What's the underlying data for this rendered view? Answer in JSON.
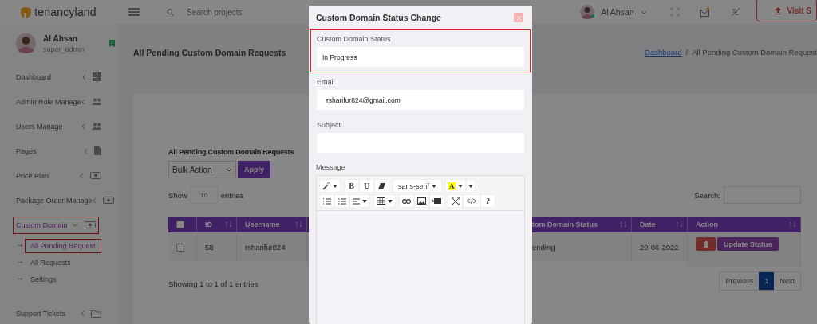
{
  "topbar": {
    "logo": "tenancyland",
    "search_placeholder": "Search projects",
    "user_name": "Al Ahsan",
    "visit_button": "Visit S"
  },
  "sidebar": {
    "profile": {
      "name": "Al Ahsan",
      "role": "super_admin"
    },
    "items": [
      {
        "label": "Dashboard",
        "selected": false,
        "highlighted": false
      },
      {
        "label": "Admin Role Manage",
        "selected": false,
        "highlighted": false
      },
      {
        "label": "Users Manage",
        "selected": false,
        "highlighted": false
      },
      {
        "label": "Pages",
        "selected": false,
        "highlighted": false
      },
      {
        "label": "Price Plan",
        "selected": false,
        "highlighted": false
      },
      {
        "label": "Package Order Manage",
        "selected": false,
        "highlighted": false
      },
      {
        "label": "Custom Domain",
        "selected": true,
        "highlighted": true,
        "expanded": true,
        "children": [
          {
            "label": "All Pending Request",
            "selected": true,
            "highlighted": true
          },
          {
            "label": "All Requests",
            "selected": false,
            "highlighted": false
          },
          {
            "label": "Settings",
            "selected": false,
            "highlighted": false
          }
        ]
      },
      {
        "label": "Support Tickets",
        "selected": false,
        "highlighted": false
      }
    ]
  },
  "page": {
    "title": "All Pending Custom Domain Requests",
    "separator": "/",
    "breadcrumb": [
      {
        "label": "Dashboard",
        "link": true
      },
      {
        "label": "All Pending Custom Domain Request",
        "link": false
      }
    ]
  },
  "card": {
    "heading": "All Pending Custom Domain Requests",
    "bulk_action": "Bulk Action",
    "apply": "Apply",
    "show": "Show",
    "page_length": "10",
    "entries": "entries",
    "search_label": "Search:",
    "table": {
      "select_all_checked": false,
      "columns": [
        {
          "kind": "text",
          "label": "ID"
        },
        {
          "kind": "text",
          "label": "Username"
        },
        {
          "kind": "text",
          "label": "tom Domain Status"
        },
        {
          "kind": "text",
          "label": "Date"
        },
        {
          "kind": "text",
          "label": "Action"
        }
      ],
      "rows": [
        {
          "checked": false,
          "cells": [
            "58",
            "rsharifur824",
            "ending",
            "29-06-2022"
          ],
          "action": "Update Status"
        }
      ]
    },
    "info": "Showing 1 to 1 of 1 entries",
    "pagination": [
      {
        "label": "Previous",
        "selected": false
      },
      {
        "label": "1",
        "selected": true
      },
      {
        "label": "Next",
        "selected": false
      }
    ]
  },
  "modal": {
    "title": "Custom Domain Status Change",
    "fields": [
      {
        "label": "Custom Domain Status",
        "value": "In Progress",
        "highlighted": true
      },
      {
        "label": "Email",
        "value": "rsharifur824@gmail.com",
        "highlighted": false
      },
      {
        "label": "Subject",
        "highlighted": false
      }
    ],
    "message_label": "Message",
    "toolbar": [
      [
        [
          {
            "kind": "magic"
          }
        ],
        [
          {
            "kind": "text",
            "label": "B"
          },
          {
            "kind": "text",
            "label": "U"
          },
          {
            "kind": "eraser"
          }
        ],
        [
          {
            "kind": "font",
            "label": "sans-serif"
          }
        ],
        [
          {
            "kind": "color",
            "label": "A"
          }
        ]
      ],
      [
        [
          {
            "kind": "ul"
          },
          {
            "kind": "ol"
          },
          {
            "kind": "align"
          }
        ],
        [
          {
            "kind": "table"
          }
        ],
        [
          {
            "kind": "link"
          },
          {
            "kind": "image"
          },
          {
            "kind": "video"
          }
        ],
        [
          {
            "kind": "fullscreen"
          },
          {
            "kind": "text",
            "label": "</>"
          },
          {
            "kind": "text",
            "label": "?"
          }
        ]
      ]
    ]
  }
}
